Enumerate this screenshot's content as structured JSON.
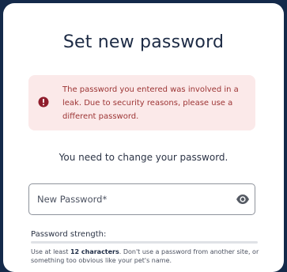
{
  "page": {
    "title": "Set new password"
  },
  "alert": {
    "icon": "error-icon",
    "message": "The password you entered was involved in a leak. Due to security reasons, please use a different password.",
    "color": "#9c3434",
    "background": "#fbe9e9"
  },
  "message": {
    "text": "You need to change your password."
  },
  "password_field": {
    "placeholder": "New Password*",
    "value": "",
    "toggle_icon": "eye-icon"
  },
  "strength": {
    "label": "Password strength:",
    "level": 0
  },
  "hint": {
    "prefix": "Use at least ",
    "emphasis": "12 characters",
    "suffix": ". Don't use a password from another site, or something too obvious like your pet's name."
  },
  "colors": {
    "background": "#142a4a",
    "card": "#ffffff",
    "title": "#1d2b45"
  }
}
